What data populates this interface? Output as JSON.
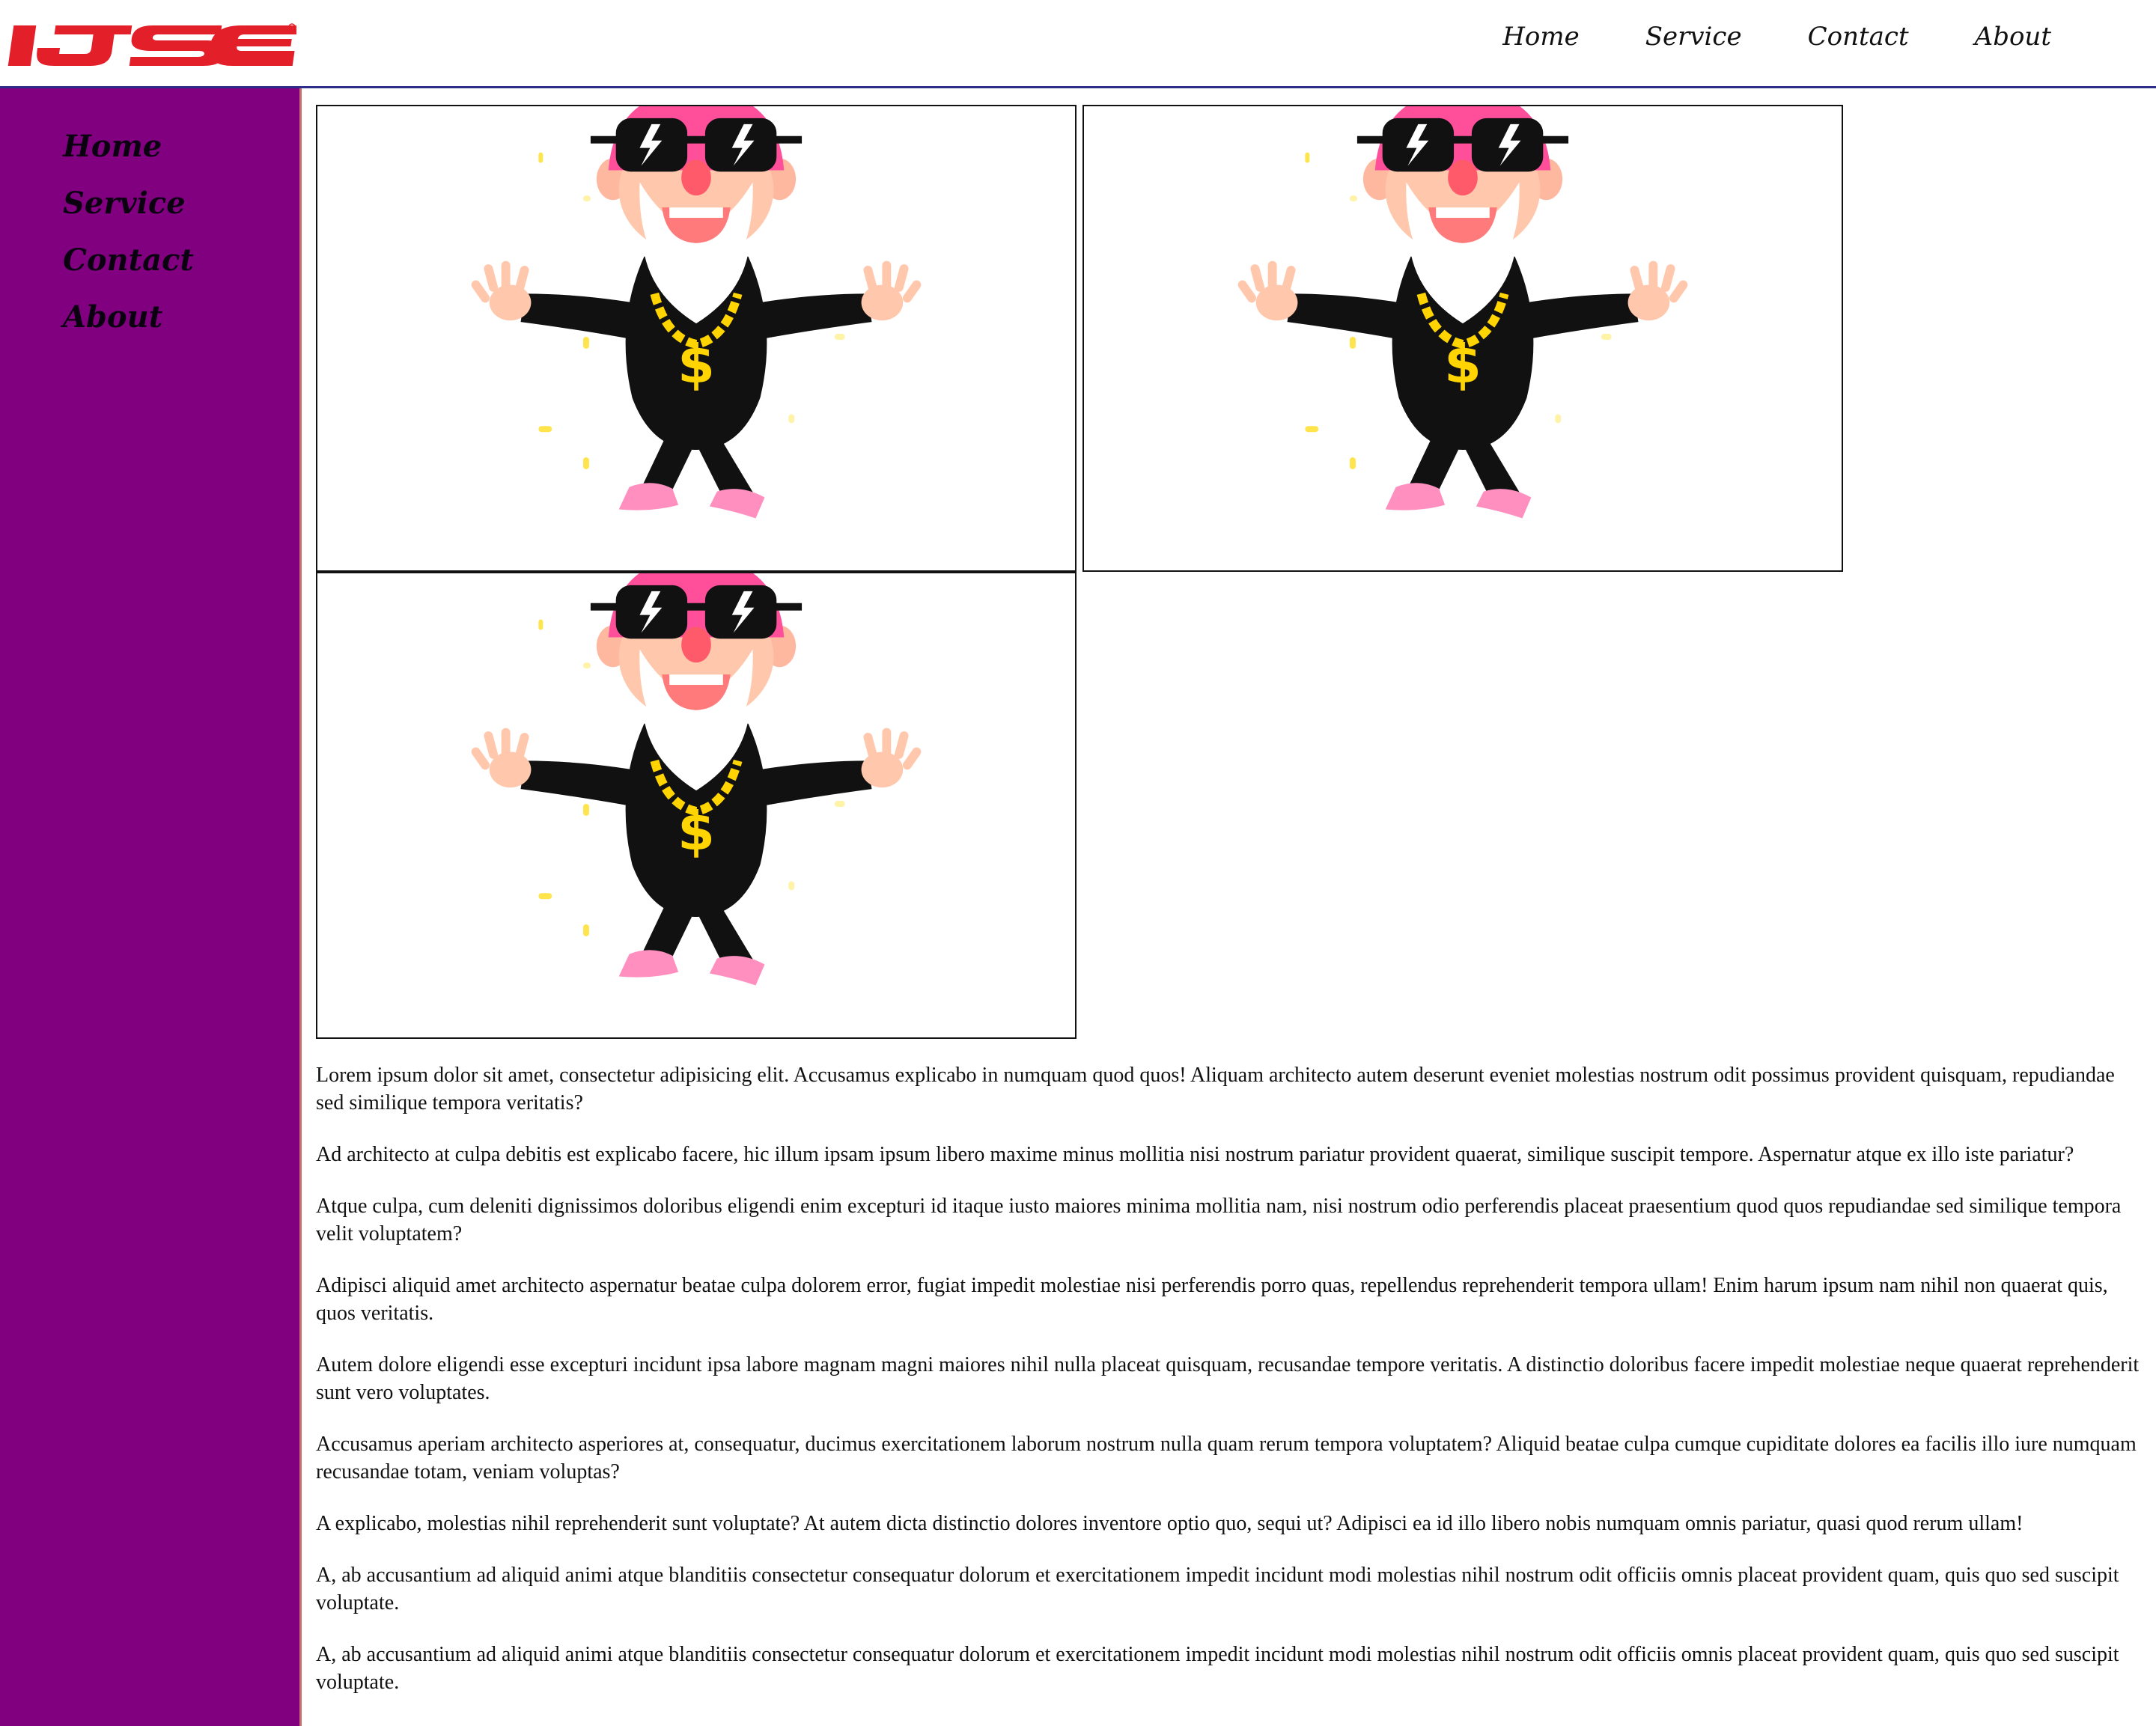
{
  "brand": {
    "logo_text": "IJSE",
    "logo_color": "#e3202a"
  },
  "top_nav": {
    "items": [
      "Home",
      "Service",
      "Contact",
      "About"
    ]
  },
  "sidebar": {
    "items": [
      "Home",
      "Service",
      "Contact",
      "About"
    ],
    "background": "#800080"
  },
  "gallery": {
    "tiles": [
      {
        "alt": "cartoon gnome with pink hat, sunglasses and gold dollar chain"
      },
      {
        "alt": "cartoon gnome with pink hat, sunglasses and gold dollar chain"
      },
      {
        "alt": "cartoon gnome with pink hat, sunglasses and gold dollar chain"
      }
    ]
  },
  "content": {
    "paragraphs": [
      "Lorem ipsum dolor sit amet, consectetur adipisicing elit. Accusamus explicabo in numquam quod quos! Aliquam architecto autem deserunt eveniet molestias nostrum odit possimus provident quisquam, repudiandae sed similique tempora veritatis?",
      "Ad architecto at culpa debitis est explicabo facere, hic illum ipsam ipsum libero maxime minus mollitia nisi nostrum pariatur provident quaerat, similique suscipit tempore. Aspernatur atque ex illo iste pariatur?",
      "Atque culpa, cum deleniti dignissimos doloribus eligendi enim excepturi id itaque iusto maiores minima mollitia nam, nisi nostrum odio perferendis placeat praesentium quod quos repudiandae sed similique tempora velit voluptatem?",
      "Adipisci aliquid amet architecto aspernatur beatae culpa dolorem error, fugiat impedit molestiae nisi perferendis porro quas, repellendus reprehenderit tempora ullam! Enim harum ipsum nam nihil non quaerat quis, quos veritatis.",
      "Autem dolore eligendi esse excepturi incidunt ipsa labore magnam magni maiores nihil nulla placeat quisquam, recusandae tempore veritatis. A distinctio doloribus facere impedit molestiae neque quaerat reprehenderit sunt vero voluptates.",
      "Accusamus aperiam architecto asperiores at, consequatur, ducimus exercitationem laborum nostrum nulla quam rerum tempora voluptatem? Aliquid beatae culpa cumque cupiditate dolores ea facilis illo iure numquam recusandae totam, veniam voluptas?",
      "A explicabo, molestias nihil reprehenderit sunt voluptate? At autem dicta distinctio dolores inventore optio quo, sequi ut? Adipisci ea id illo libero nobis numquam omnis pariatur, quasi quod rerum ullam!",
      "A, ab accusantium ad aliquid animi atque blanditiis consectetur consequatur dolorum et exercitationem impedit incidunt modi molestias nihil nostrum odit officiis omnis placeat provident quam, quis quo sed suscipit voluptate.",
      "A, ab accusantium ad aliquid animi atque blanditiis consectetur consequatur dolorum et exercitationem impedit incidunt modi molestias nihil nostrum odit officiis omnis placeat provident quam, quis quo sed suscipit voluptate."
    ]
  }
}
